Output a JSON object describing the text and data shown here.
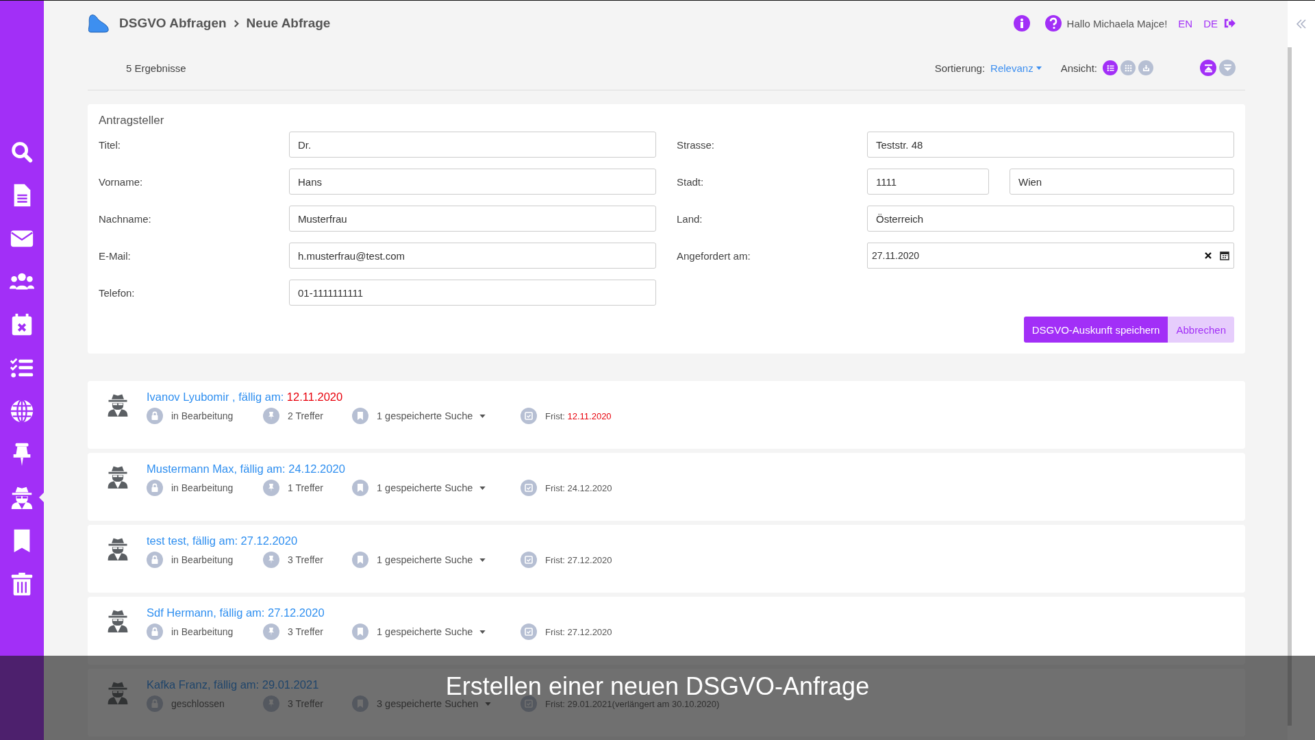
{
  "sidebar": {
    "items": [
      {
        "selected": false
      },
      {
        "selected": false
      },
      {
        "selected": false
      },
      {
        "selected": false
      },
      {
        "selected": false
      },
      {
        "selected": false
      },
      {
        "selected": false
      },
      {
        "selected": false
      },
      {
        "selected": true
      },
      {
        "selected": false
      },
      {
        "selected": false
      }
    ]
  },
  "breadcrumb": [
    "DSGVO Abfragen",
    "Neue Abfrage"
  ],
  "header": {
    "greeting": "Hallo Michaela Majce!",
    "languages": [
      "EN",
      "DE"
    ]
  },
  "toolbar": {
    "results": "5 Ergebnisse",
    "sort_label": "Sortierung:",
    "sort_value": "Relevanz",
    "view_label": "Ansicht:",
    "views": [
      {
        "selected": true
      },
      {
        "selected": false
      },
      {
        "selected": false
      }
    ],
    "toggles": [
      {
        "selected": true
      },
      {
        "selected": false
      }
    ]
  },
  "form": {
    "title": "Antragsteller",
    "left": [
      {
        "label": "Titel:",
        "value": "Dr."
      },
      {
        "label": "Vorname:",
        "value": "Hans"
      },
      {
        "label": "Nachname:",
        "value": "Musterfrau"
      },
      {
        "label": "E-Mail:",
        "value": "h.musterfrau@test.com"
      },
      {
        "label": "Telefon:",
        "value": "01-1111111111"
      }
    ],
    "right": [
      {
        "label": "Strasse:",
        "kind": "text",
        "values": [
          "Teststr. 48"
        ]
      },
      {
        "label": "Stadt:",
        "kind": "text",
        "values": [
          "1111",
          "Wien"
        ]
      },
      {
        "label": "Land:",
        "kind": "text",
        "values": [
          "Österreich"
        ]
      },
      {
        "label": "Angefordert am:",
        "kind": "date",
        "values": [
          "27.11.2020"
        ]
      }
    ],
    "buttons": [
      {
        "label": "DSGVO-Auskunft speichern",
        "kind": "primary"
      },
      {
        "label": "Abbrechen",
        "kind": "secondary"
      }
    ]
  },
  "requests": [
    {
      "title": "Ivanov Lyubomir , fällig am:",
      "due": "12.11.2020",
      "overdue": true,
      "status": "in Bearbeitung",
      "hits": "2 Treffer",
      "searches": "1 gespeicherte Suche",
      "deadline_label": "Frist:",
      "deadline": "12.11.2020"
    },
    {
      "title": "Mustermann Max, fällig am:",
      "due": "24.12.2020",
      "overdue": false,
      "status": "in Bearbeitung",
      "hits": "1 Treffer",
      "searches": "1 gespeicherte Suche",
      "deadline_label": "Frist:",
      "deadline": "24.12.2020"
    },
    {
      "title": "test test, fällig am:",
      "due": "27.12.2020",
      "overdue": false,
      "status": "in Bearbeitung",
      "hits": "3 Treffer",
      "searches": "1 gespeicherte Suche",
      "deadline_label": "Frist:",
      "deadline": "27.12.2020"
    },
    {
      "title": "Sdf Hermann, fällig am:",
      "due": "27.12.2020",
      "overdue": false,
      "status": "in Bearbeitung",
      "hits": "3 Treffer",
      "searches": "1 gespeicherte Suche",
      "deadline_label": "Frist:",
      "deadline": "27.12.2020"
    },
    {
      "title": "Kafka Franz, fällig am:",
      "due": "29.01.2021",
      "overdue": false,
      "status": "geschlossen",
      "hits": "3 Treffer",
      "searches": "3 gespeicherte Suchen",
      "deadline_label": "Frist:",
      "deadline": "29.01.2021",
      "note": "(verlängert am 30.10.2020)"
    }
  ],
  "caption": "Erstellen einer neuen DSGVO-Anfrage"
}
